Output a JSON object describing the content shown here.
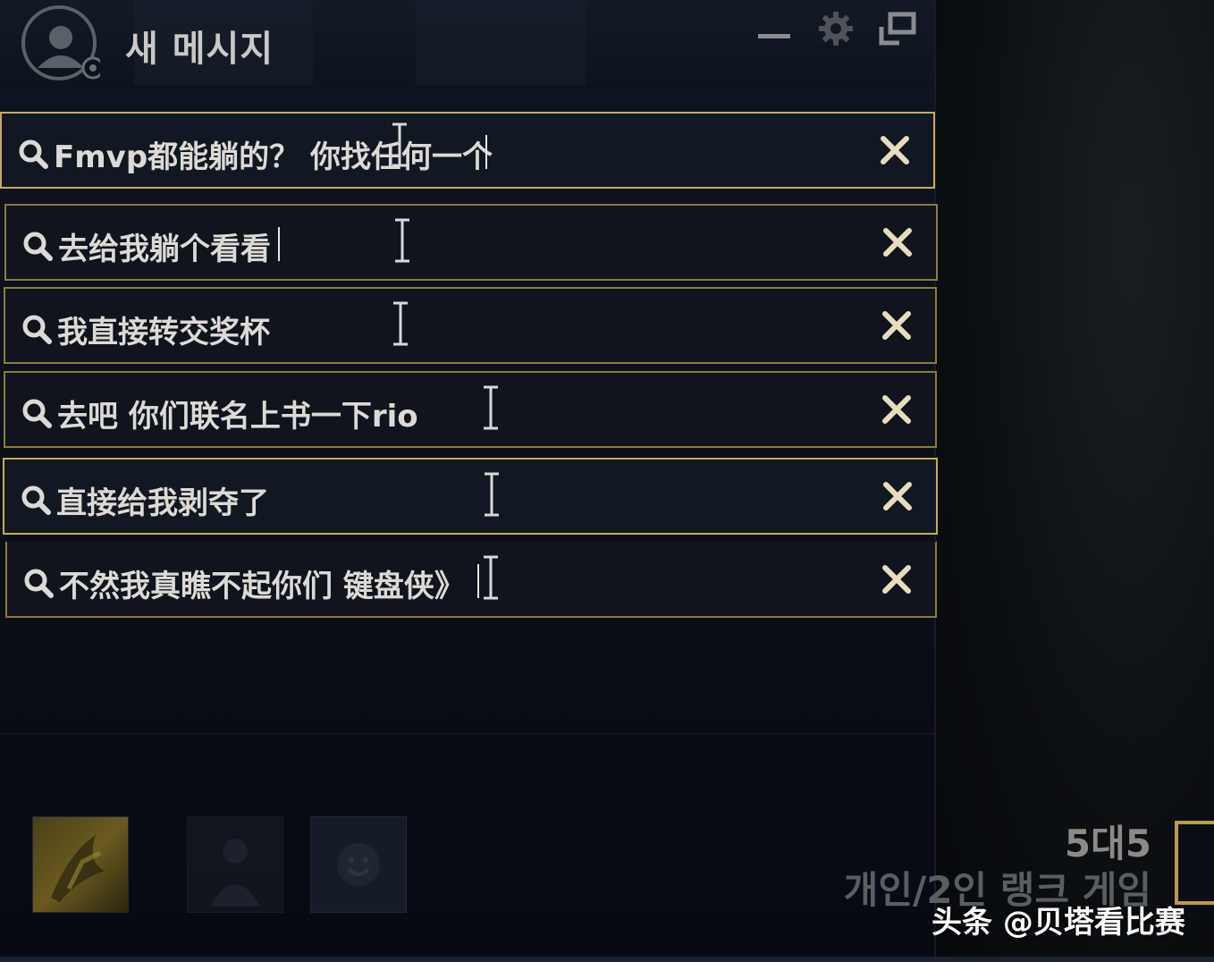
{
  "header": {
    "title": "새 메시지"
  },
  "messages": [
    {
      "text": "Fmvp都能躺的？ 你找任何一个"
    },
    {
      "text": "去给我躺个看看"
    },
    {
      "text": "我直接转交奖杯"
    },
    {
      "text": "去吧 你们联名上书一下rio"
    },
    {
      "text": "直接给我剥夺了"
    },
    {
      "text": "不然我真瞧不起你们 键盘侠》"
    }
  ],
  "game_mode": {
    "title": "5대5",
    "subtitle": "개인/2인 랭크 게임"
  },
  "watermark": "头条 @贝塔看比赛",
  "colors": {
    "border_gold": "#c8aa5b",
    "close_icon": "#e8dcc0",
    "background": "#0b0f17"
  },
  "icons": [
    "user-avatar-icon",
    "minimize-icon",
    "gear-icon",
    "popout-icon",
    "search-icon",
    "close-icon"
  ]
}
